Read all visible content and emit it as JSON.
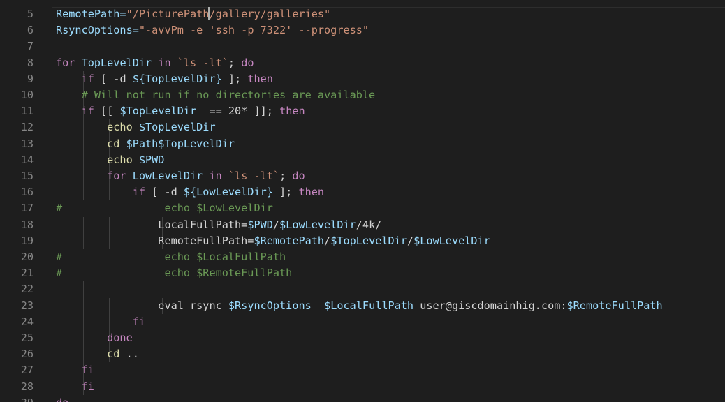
{
  "editor": {
    "lines": [
      {
        "n": "5",
        "indent": 0,
        "tokens": [
          {
            "t": "RemotePath=",
            "c": "t-var"
          },
          {
            "t": "\"/PicturePath",
            "c": "t-str"
          },
          {
            "t": "",
            "c": "cursor"
          },
          {
            "t": "/gallery/galleries\"",
            "c": "t-str"
          }
        ]
      },
      {
        "n": "6",
        "indent": 0,
        "tokens": [
          {
            "t": "RsyncOptions=",
            "c": "t-var"
          },
          {
            "t": "\"-avvPm -e 'ssh -p 7322' --progress\"",
            "c": "t-str"
          }
        ]
      },
      {
        "n": "7",
        "indent": 0,
        "tokens": []
      },
      {
        "n": "8",
        "indent": 0,
        "tokens": [
          {
            "t": "for ",
            "c": "t-kw"
          },
          {
            "t": "TopLevelDir ",
            "c": "t-var"
          },
          {
            "t": "in ",
            "c": "t-kw"
          },
          {
            "t": "`ls -lt`",
            "c": "t-str"
          },
          {
            "t": "; ",
            "c": "t-txt"
          },
          {
            "t": "do",
            "c": "t-kw"
          }
        ]
      },
      {
        "n": "9",
        "indent": 1,
        "tokens": [
          {
            "t": "    if ",
            "c": "t-kw"
          },
          {
            "t": "[ -d ",
            "c": "t-txt"
          },
          {
            "t": "${TopLevelDir}",
            "c": "t-var"
          },
          {
            "t": " ]; ",
            "c": "t-txt"
          },
          {
            "t": "then",
            "c": "t-kw"
          }
        ]
      },
      {
        "n": "10",
        "indent": 1,
        "tokens": [
          {
            "t": "    # Will not run if no directories are available",
            "c": "t-cmt"
          }
        ]
      },
      {
        "n": "11",
        "indent": 1,
        "tokens": [
          {
            "t": "    if ",
            "c": "t-kw"
          },
          {
            "t": "[[ ",
            "c": "t-txt"
          },
          {
            "t": "$TopLevelDir",
            "c": "t-var"
          },
          {
            "t": "  == ",
            "c": "t-txt"
          },
          {
            "t": "20",
            "c": "t-txt"
          },
          {
            "t": "* ]]; ",
            "c": "t-txt"
          },
          {
            "t": "then",
            "c": "t-kw"
          }
        ]
      },
      {
        "n": "12",
        "indent": 2,
        "tokens": [
          {
            "t": "        echo ",
            "c": "t-cmd"
          },
          {
            "t": "$TopLevelDir",
            "c": "t-var"
          }
        ]
      },
      {
        "n": "13",
        "indent": 2,
        "tokens": [
          {
            "t": "        cd ",
            "c": "t-cmd"
          },
          {
            "t": "$Path$TopLevelDir",
            "c": "t-var"
          }
        ]
      },
      {
        "n": "14",
        "indent": 2,
        "tokens": [
          {
            "t": "        echo ",
            "c": "t-cmd"
          },
          {
            "t": "$PWD",
            "c": "t-var"
          }
        ]
      },
      {
        "n": "15",
        "indent": 2,
        "tokens": [
          {
            "t": "        for ",
            "c": "t-kw"
          },
          {
            "t": "LowLevelDir ",
            "c": "t-var"
          },
          {
            "t": "in ",
            "c": "t-kw"
          },
          {
            "t": "`ls -lt`",
            "c": "t-str"
          },
          {
            "t": "; ",
            "c": "t-txt"
          },
          {
            "t": "do",
            "c": "t-kw"
          }
        ]
      },
      {
        "n": "16",
        "indent": 3,
        "tokens": [
          {
            "t": "            if ",
            "c": "t-kw"
          },
          {
            "t": "[ -d ",
            "c": "t-txt"
          },
          {
            "t": "${LowLevelDir}",
            "c": "t-var"
          },
          {
            "t": " ]; ",
            "c": "t-txt"
          },
          {
            "t": "then",
            "c": "t-kw"
          }
        ]
      },
      {
        "n": "17",
        "indent": 0,
        "tokens": [
          {
            "t": "#                echo $LowLevelDir",
            "c": "t-cmt"
          }
        ]
      },
      {
        "n": "18",
        "indent": 4,
        "tokens": [
          {
            "t": "                LocalFullPath=",
            "c": "t-txt"
          },
          {
            "t": "$PWD",
            "c": "t-var"
          },
          {
            "t": "/",
            "c": "t-txt"
          },
          {
            "t": "$LowLevelDir",
            "c": "t-var"
          },
          {
            "t": "/4k/",
            "c": "t-txt"
          }
        ]
      },
      {
        "n": "19",
        "indent": 4,
        "tokens": [
          {
            "t": "                RemoteFullPath=",
            "c": "t-txt"
          },
          {
            "t": "$RemotePath",
            "c": "t-var"
          },
          {
            "t": "/",
            "c": "t-txt"
          },
          {
            "t": "$TopLevelDir",
            "c": "t-var"
          },
          {
            "t": "/",
            "c": "t-txt"
          },
          {
            "t": "$LowLevelDir",
            "c": "t-var"
          }
        ]
      },
      {
        "n": "20",
        "indent": 0,
        "tokens": [
          {
            "t": "#                echo $LocalFullPath",
            "c": "t-cmt"
          }
        ]
      },
      {
        "n": "21",
        "indent": 0,
        "tokens": [
          {
            "t": "#                echo $RemoteFullPath",
            "c": "t-cmt"
          }
        ]
      },
      {
        "n": "22",
        "indent": 1,
        "tokens": []
      },
      {
        "n": "23",
        "indent": 4,
        "tokens": [
          {
            "t": "                eval rsync ",
            "c": "t-txt"
          },
          {
            "t": "$RsyncOptions",
            "c": "t-var"
          },
          {
            "t": "  ",
            "c": "t-txt"
          },
          {
            "t": "$LocalFullPath",
            "c": "t-var"
          },
          {
            "t": " user@giscdomainhig.com:",
            "c": "t-txt"
          },
          {
            "t": "$RemoteFullPath",
            "c": "t-var"
          }
        ]
      },
      {
        "n": "24",
        "indent": 3,
        "tokens": [
          {
            "t": "            fi",
            "c": "t-kw"
          }
        ]
      },
      {
        "n": "25",
        "indent": 2,
        "tokens": [
          {
            "t": "        done",
            "c": "t-kw"
          }
        ]
      },
      {
        "n": "26",
        "indent": 2,
        "tokens": [
          {
            "t": "        cd ",
            "c": "t-cmd"
          },
          {
            "t": "..",
            "c": "t-txt"
          }
        ]
      },
      {
        "n": "27",
        "indent": 1,
        "tokens": [
          {
            "t": "    fi",
            "c": "t-kw"
          }
        ]
      },
      {
        "n": "28",
        "indent": 1,
        "tokens": [
          {
            "t": "    fi",
            "c": "t-kw"
          }
        ]
      },
      {
        "n": "29",
        "indent": 0,
        "tokens": [
          {
            "t": "do",
            "c": "t-kw"
          }
        ]
      }
    ]
  }
}
